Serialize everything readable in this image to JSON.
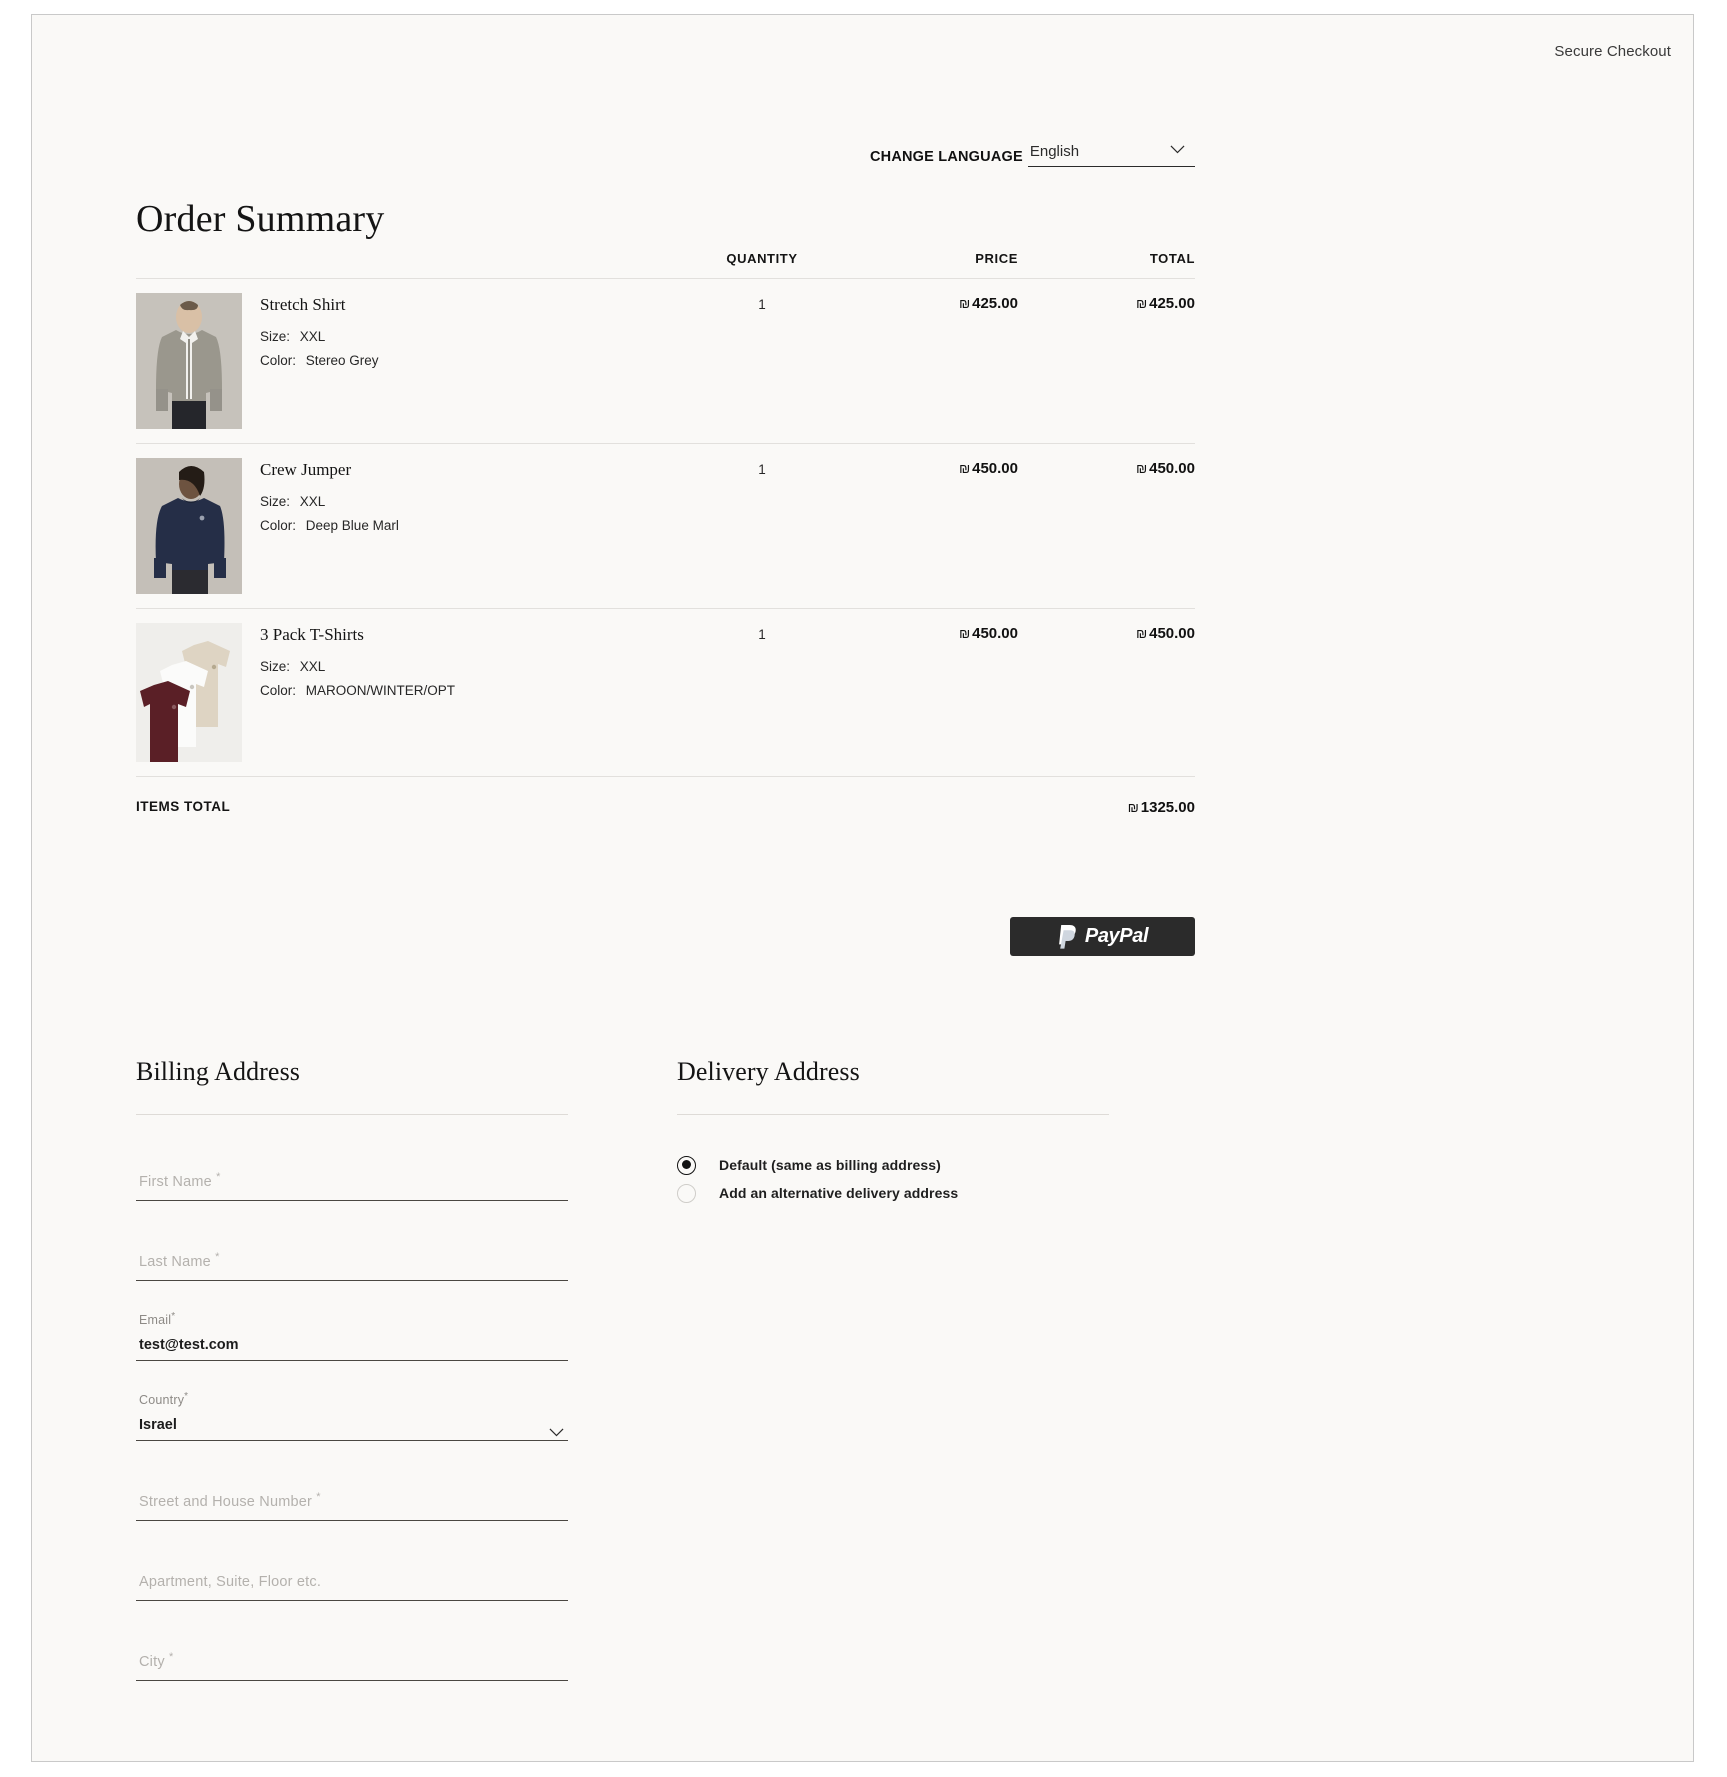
{
  "header": {
    "secure_checkout": "Secure Checkout"
  },
  "language": {
    "label": "CHANGE LANGUAGE",
    "value": "English"
  },
  "order_summary": {
    "title": "Order Summary",
    "columns": {
      "quantity": "QUANTITY",
      "price": "PRICE",
      "total": "TOTAL"
    },
    "items": [
      {
        "name": "Stretch Shirt",
        "size_label": "Size:",
        "size_value": "XXL",
        "color_label": "Color:",
        "color_value": "Stereo Grey",
        "quantity": "1",
        "currency": "₪",
        "price": "425.00",
        "total": "425.00"
      },
      {
        "name": "Crew Jumper",
        "size_label": "Size:",
        "size_value": "XXL",
        "color_label": "Color:",
        "color_value": "Deep Blue Marl",
        "quantity": "1",
        "currency": "₪",
        "price": "450.00",
        "total": "450.00"
      },
      {
        "name": "3 Pack T-Shirts",
        "size_label": "Size:",
        "size_value": "XXL",
        "color_label": "Color:",
        "color_value": "MAROON/WINTER/OPT",
        "quantity": "1",
        "currency": "₪",
        "price": "450.00",
        "total": "450.00"
      }
    ],
    "items_total_label": "ITEMS TOTAL",
    "items_total_currency": "₪",
    "items_total_value": "1325.00"
  },
  "paypal": {
    "label": "PayPal"
  },
  "billing": {
    "title": "Billing Address",
    "fields": [
      {
        "placeholder": "First Name",
        "required": true,
        "value": ""
      },
      {
        "placeholder": "Last Name",
        "required": true,
        "value": ""
      },
      {
        "placeholder": "Email",
        "required": true,
        "value": "test@test.com"
      },
      {
        "placeholder": "Country",
        "required": true,
        "value": "Israel"
      },
      {
        "placeholder": "Street and House Number",
        "required": true,
        "value": ""
      },
      {
        "placeholder": "Apartment, Suite, Floor etc.",
        "required": false,
        "value": ""
      },
      {
        "placeholder": "City",
        "required": true,
        "value": ""
      }
    ]
  },
  "delivery": {
    "title": "Delivery Address",
    "options": [
      {
        "label": "Default (same as billing address)",
        "selected": true
      },
      {
        "label": "Add an alternative delivery address",
        "selected": false
      }
    ]
  },
  "colors": {
    "page_bg": "#faf9f7",
    "text": "#1c1c1c",
    "muted": "#b4b1ad",
    "rule": "#e2e0dd",
    "paypal_bg": "#2b2b2b"
  }
}
